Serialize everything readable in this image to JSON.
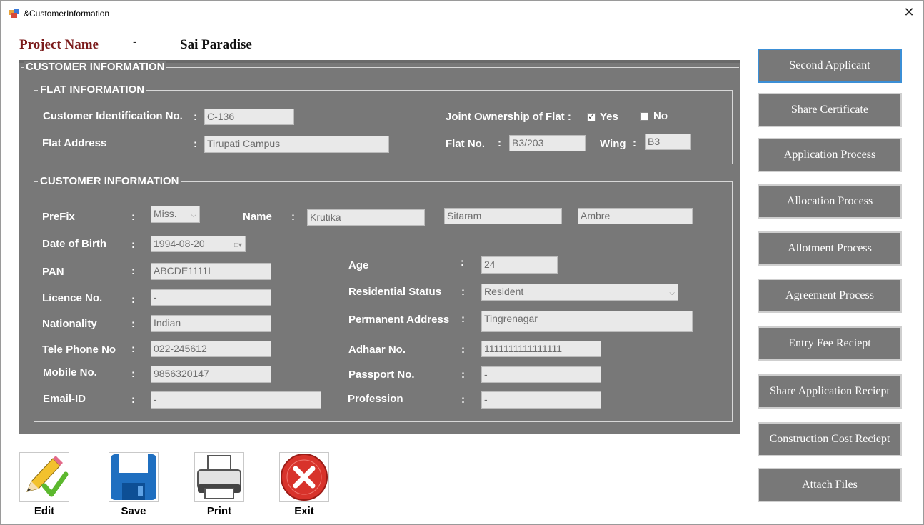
{
  "window": {
    "title": "&CustomerInformation",
    "close_glyph": "✕",
    "app_icon": "form-app-icon"
  },
  "project": {
    "label": "Project Name",
    "separator": "-",
    "value": "Sai Paradise"
  },
  "outer_group": {
    "title": "CUSTOMER INFORMATION"
  },
  "flat_info": {
    "title": "FLAT INFORMATION",
    "customer_id_label": "Customer Identification No.",
    "customer_id_value": "C-136",
    "flat_address_label": "Flat Address",
    "flat_address_value": "Tirupati Campus",
    "joint_label": "Joint Ownership of Flat :",
    "yes_label": "Yes",
    "no_label": "No",
    "yes_checked": true,
    "no_checked": false,
    "flat_no_label": "Flat No.",
    "flat_no_value": "B3/203",
    "wing_label": "Wing",
    "wing_value": "B3"
  },
  "customer_info": {
    "title": "CUSTOMER INFORMATION",
    "prefix_label": "PreFix",
    "prefix_value": "Miss.",
    "name_label": "Name",
    "first_name": "Krutika",
    "middle_name": "Sitaram",
    "last_name": "Ambre",
    "dob_label": "Date of Birth",
    "dob_value": "1994-08-20",
    "pan_label": "PAN",
    "pan_value": "ABCDE1111L",
    "licence_label": "Licence No.",
    "licence_value": "-",
    "nationality_label": "Nationality",
    "nationality_value": "Indian",
    "telephone_label": "Tele Phone No",
    "telephone_value": "022-245612",
    "mobile_label": "Mobile No.",
    "mobile_value": "9856320147",
    "email_label": "Email-ID",
    "email_value": "-",
    "age_label": "Age",
    "age_value": "24",
    "residential_label": "Residential Status",
    "residential_value": "Resident",
    "permanent_label": "Permanent Address",
    "permanent_value": "Tingrenagar",
    "adhaar_label": "Adhaar No.",
    "adhaar_value": "1111111111111111",
    "passport_label": "Passport No.",
    "passport_value": "-",
    "profession_label": "Profession",
    "profession_value": "-",
    "colon": ":"
  },
  "side_buttons": [
    "Second Applicant",
    "Share Certificate",
    "Application Process",
    "Allocation Process",
    "Allotment Process",
    "Agreement Process",
    "Entry Fee Reciept",
    "Share Application Reciept",
    "Construction Cost Reciept",
    "Attach Files"
  ],
  "toolbar": {
    "edit": "Edit",
    "save": "Save",
    "print": "Print",
    "exit": "Exit"
  },
  "colors": {
    "panel": "#787878",
    "project_label": "#7b1a1a",
    "active_border": "#3b8fd6",
    "exit_red": "#d8332b",
    "save_blue": "#1f6fc0"
  }
}
